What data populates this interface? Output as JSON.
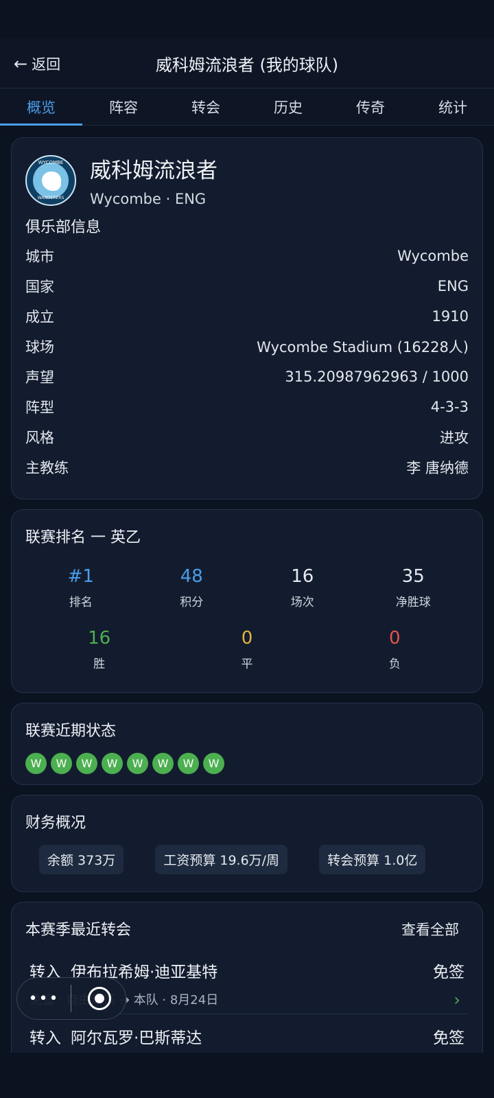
{
  "header": {
    "back_label": "返回",
    "title": "威科姆流浪者 (我的球队)"
  },
  "tabs": [
    {
      "label": "概览",
      "active": true
    },
    {
      "label": "阵容"
    },
    {
      "label": "转会"
    },
    {
      "label": "历史"
    },
    {
      "label": "传奇"
    },
    {
      "label": "统计"
    }
  ],
  "club": {
    "name": "威科姆流浪者",
    "subtitle": "Wycombe · ENG",
    "crest_top": "WYCOMBE",
    "crest_bottom": "WANDERERS",
    "section_title": "俱乐部信息",
    "info": [
      {
        "label": "城市",
        "value": "Wycombe"
      },
      {
        "label": "国家",
        "value": "ENG"
      },
      {
        "label": "成立",
        "value": "1910"
      },
      {
        "label": "球场",
        "value": "Wycombe Stadium (16228人)"
      },
      {
        "label": "声望",
        "value": "315.20987962963 / 1000"
      },
      {
        "label": "阵型",
        "value": "4-3-3"
      },
      {
        "label": "风格",
        "value": "进攻"
      },
      {
        "label": "主教练",
        "value": "李 唐纳德"
      }
    ]
  },
  "league": {
    "title": "联赛排名 一 英乙",
    "rank": {
      "value": "#1",
      "label": "排名"
    },
    "points": {
      "value": "48",
      "label": "积分"
    },
    "played": {
      "value": "16",
      "label": "场次"
    },
    "goal_diff": {
      "value": "35",
      "label": "净胜球"
    },
    "wins": {
      "value": "16",
      "label": "胜"
    },
    "draws": {
      "value": "0",
      "label": "平"
    },
    "losses": {
      "value": "0",
      "label": "负"
    }
  },
  "form": {
    "title": "联赛近期状态",
    "results": [
      "W",
      "W",
      "W",
      "W",
      "W",
      "W",
      "W",
      "W"
    ]
  },
  "finance": {
    "title": "财务概况",
    "balance": "余额 373万",
    "wage_budget": "工资预算 19.6万/周",
    "transfer_budget": "转会预算 1.0亿"
  },
  "transfers": {
    "title": "本赛季最近转会",
    "view_all": "查看全部",
    "items": [
      {
        "direction": "转入",
        "player": "伊布拉希姆·迪亚基特",
        "fee": "免签",
        "detail": "免签 · 自由球员 → 本队 · 8月24日"
      },
      {
        "direction": "转入",
        "player": "阿尔瓦罗·巴斯蒂达",
        "fee": "免签"
      }
    ]
  },
  "colors": {
    "accent": "#4a9eea",
    "win": "#4caf50",
    "draw": "#e3b341",
    "loss": "#e5534b"
  },
  "floating_controls": {
    "more_glyph": "•••"
  }
}
